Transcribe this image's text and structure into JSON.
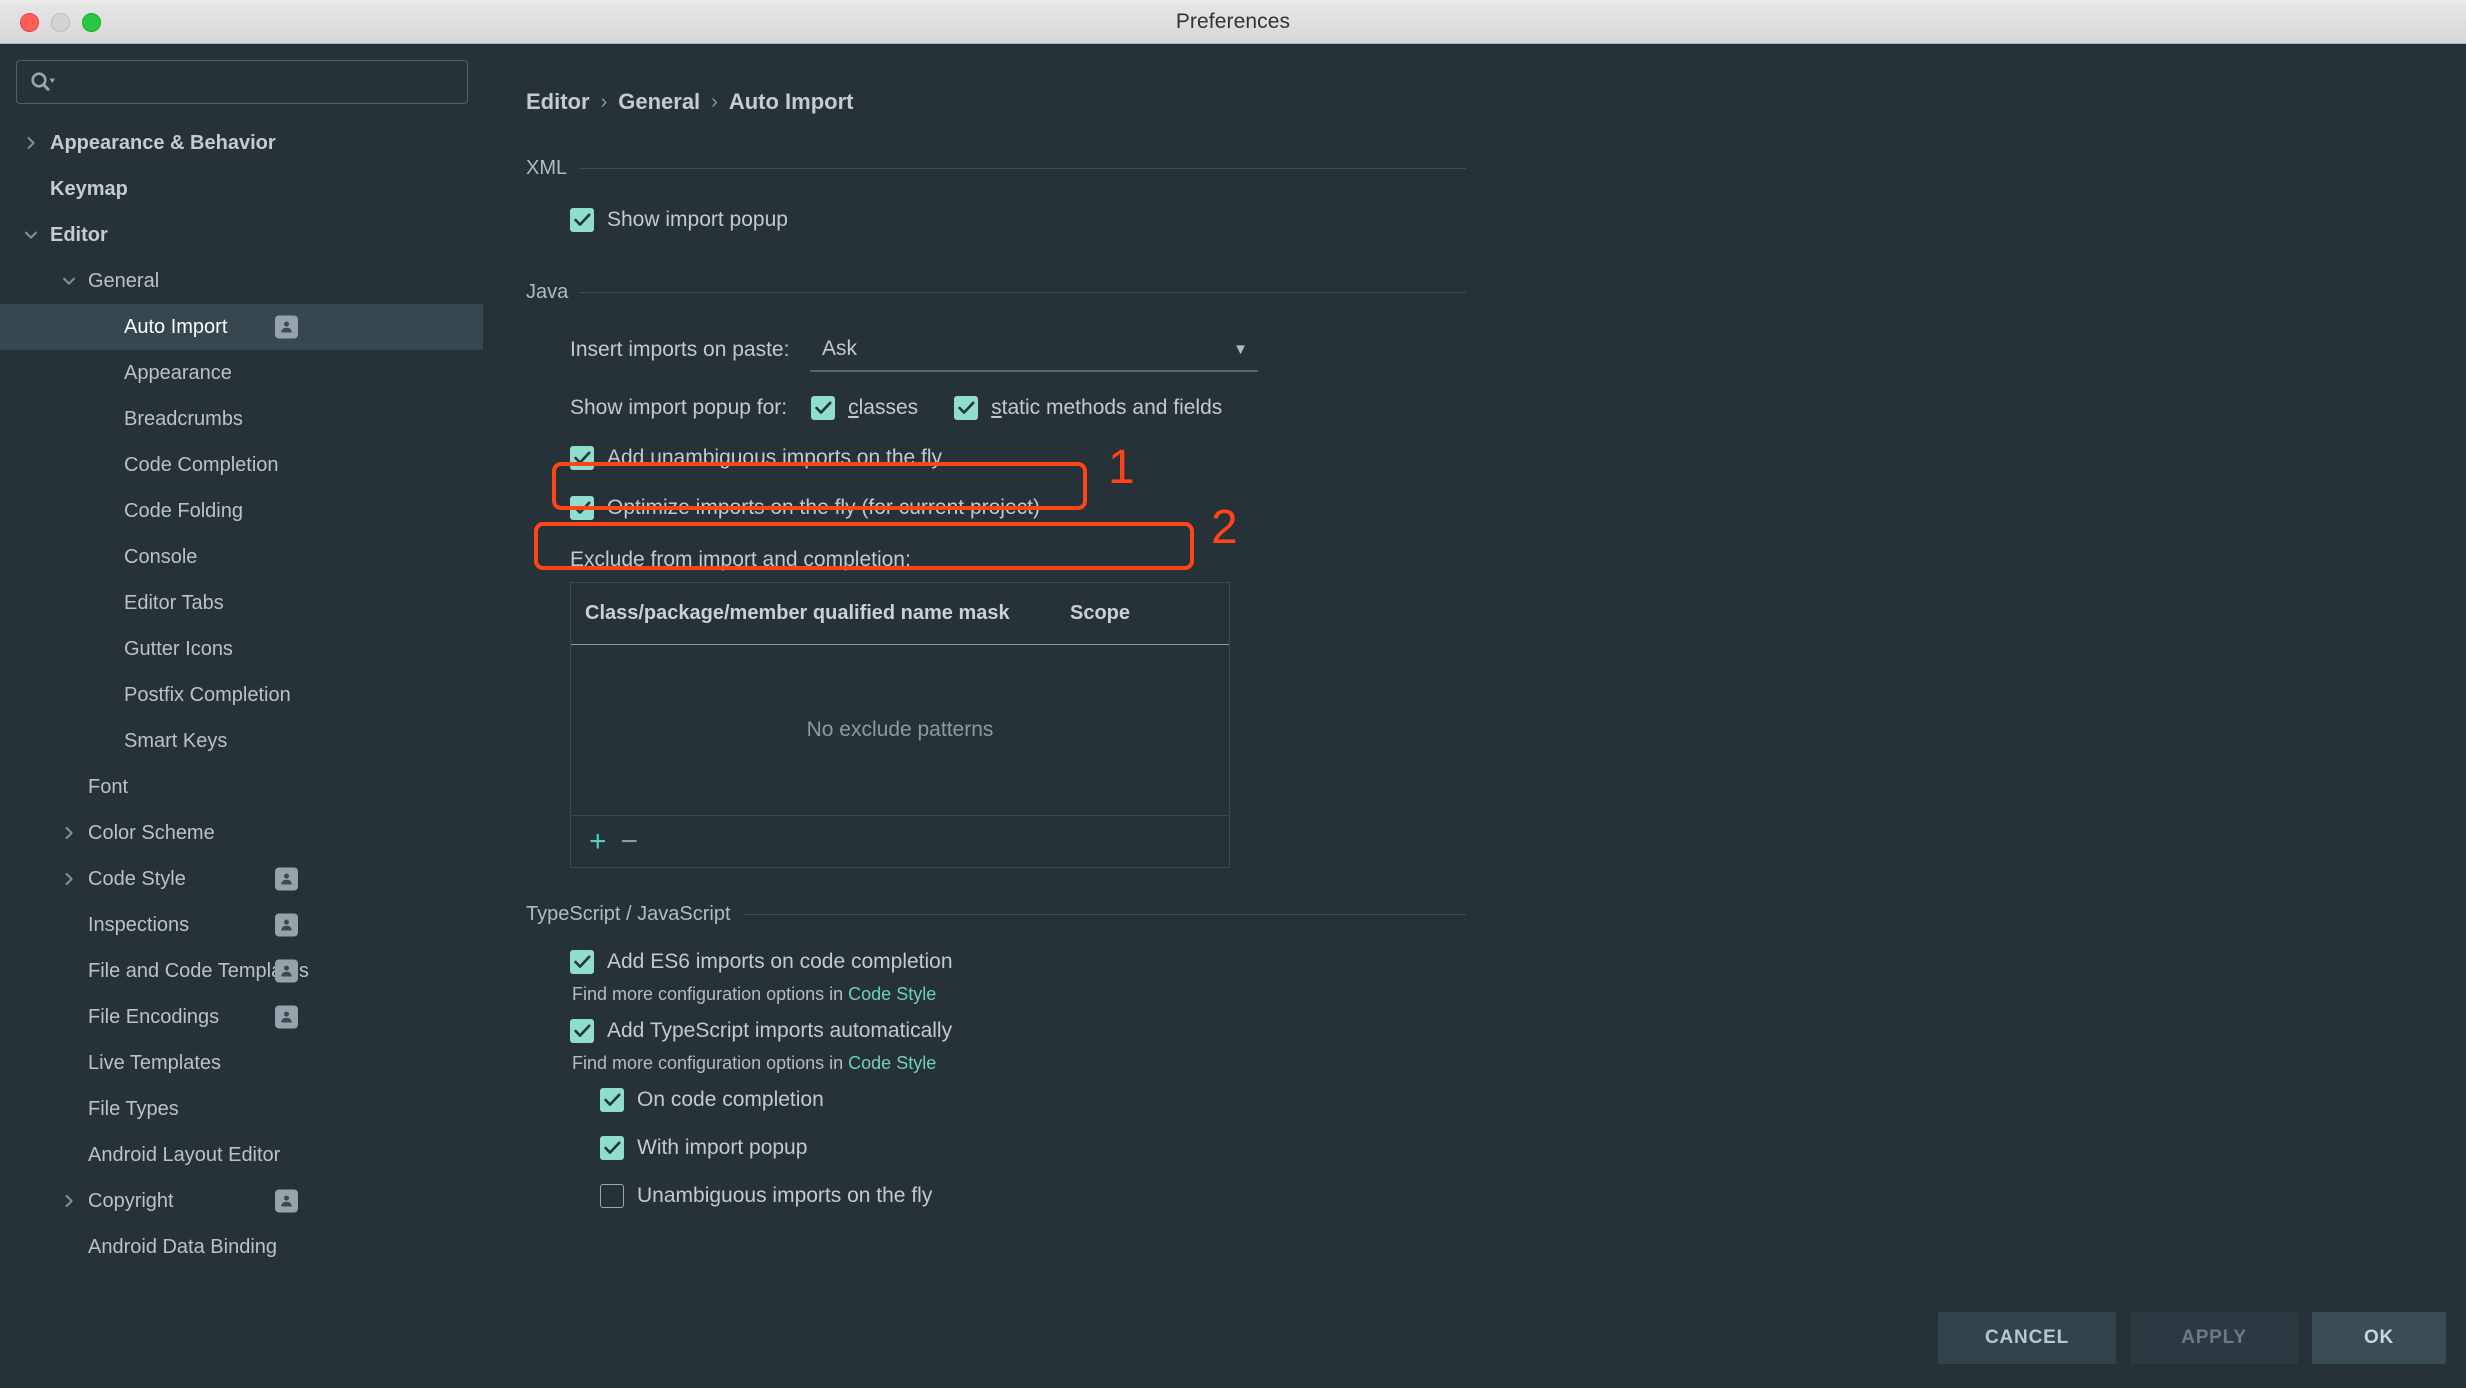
{
  "window": {
    "title": "Preferences"
  },
  "traffic_lights": {
    "close": "close",
    "minimize": "minimize",
    "zoom": "zoom"
  },
  "search": {
    "value": "",
    "placeholder": ""
  },
  "sidebar": {
    "items": [
      {
        "label": "Appearance & Behavior",
        "indent": 0,
        "chevron": "right",
        "bold": true,
        "selected": false,
        "badge": false
      },
      {
        "label": "Keymap",
        "indent": 0,
        "chevron": "none",
        "bold": true,
        "selected": false,
        "badge": false
      },
      {
        "label": "Editor",
        "indent": 0,
        "chevron": "down",
        "bold": true,
        "selected": false,
        "badge": false
      },
      {
        "label": "General",
        "indent": 1,
        "chevron": "down",
        "bold": false,
        "selected": false,
        "badge": false
      },
      {
        "label": "Auto Import",
        "indent": 2,
        "chevron": "none",
        "bold": false,
        "selected": true,
        "badge": true
      },
      {
        "label": "Appearance",
        "indent": 2,
        "chevron": "none",
        "bold": false,
        "selected": false,
        "badge": false
      },
      {
        "label": "Breadcrumbs",
        "indent": 2,
        "chevron": "none",
        "bold": false,
        "selected": false,
        "badge": false
      },
      {
        "label": "Code Completion",
        "indent": 2,
        "chevron": "none",
        "bold": false,
        "selected": false,
        "badge": false
      },
      {
        "label": "Code Folding",
        "indent": 2,
        "chevron": "none",
        "bold": false,
        "selected": false,
        "badge": false
      },
      {
        "label": "Console",
        "indent": 2,
        "chevron": "none",
        "bold": false,
        "selected": false,
        "badge": false
      },
      {
        "label": "Editor Tabs",
        "indent": 2,
        "chevron": "none",
        "bold": false,
        "selected": false,
        "badge": false
      },
      {
        "label": "Gutter Icons",
        "indent": 2,
        "chevron": "none",
        "bold": false,
        "selected": false,
        "badge": false
      },
      {
        "label": "Postfix Completion",
        "indent": 2,
        "chevron": "none",
        "bold": false,
        "selected": false,
        "badge": false
      },
      {
        "label": "Smart Keys",
        "indent": 2,
        "chevron": "none",
        "bold": false,
        "selected": false,
        "badge": false
      },
      {
        "label": "Font",
        "indent": 1,
        "chevron": "none",
        "bold": false,
        "selected": false,
        "badge": false
      },
      {
        "label": "Color Scheme",
        "indent": 1,
        "chevron": "right",
        "bold": false,
        "selected": false,
        "badge": false
      },
      {
        "label": "Code Style",
        "indent": 1,
        "chevron": "right",
        "bold": false,
        "selected": false,
        "badge": true
      },
      {
        "label": "Inspections",
        "indent": 1,
        "chevron": "none",
        "bold": false,
        "selected": false,
        "badge": true
      },
      {
        "label": "File and Code Templates",
        "indent": 1,
        "chevron": "none",
        "bold": false,
        "selected": false,
        "badge": true
      },
      {
        "label": "File Encodings",
        "indent": 1,
        "chevron": "none",
        "bold": false,
        "selected": false,
        "badge": true
      },
      {
        "label": "Live Templates",
        "indent": 1,
        "chevron": "none",
        "bold": false,
        "selected": false,
        "badge": false
      },
      {
        "label": "File Types",
        "indent": 1,
        "chevron": "none",
        "bold": false,
        "selected": false,
        "badge": false
      },
      {
        "label": "Android Layout Editor",
        "indent": 1,
        "chevron": "none",
        "bold": false,
        "selected": false,
        "badge": false
      },
      {
        "label": "Copyright",
        "indent": 1,
        "chevron": "right",
        "bold": false,
        "selected": false,
        "badge": true
      },
      {
        "label": "Android Data Binding",
        "indent": 1,
        "chevron": "none",
        "bold": false,
        "selected": false,
        "badge": false
      }
    ]
  },
  "breadcrumb": {
    "parts": [
      "Editor",
      "General",
      "Auto Import"
    ],
    "separator": "›"
  },
  "sections": {
    "xml": {
      "title": "XML",
      "show_import_popup": {
        "label": "Show import popup",
        "checked": true
      }
    },
    "java": {
      "title": "Java",
      "insert_imports_on_paste": {
        "label": "Insert imports on paste:",
        "value": "Ask"
      },
      "show_import_popup_for": {
        "label": "Show import popup for:",
        "options": [
          {
            "label": "classes",
            "mnemonic": "c",
            "rest": "lasses",
            "checked": true
          },
          {
            "label": "static methods and fields",
            "mnemonic": "s",
            "rest": "tatic methods and fields",
            "checked": true
          }
        ]
      },
      "add_unambiguous": {
        "label": "Add unambiguous imports on the fly",
        "checked": true
      },
      "optimize_imports": {
        "label": "Optimize imports on the fly (for current project)",
        "checked": true
      },
      "exclude_label": "Exclude from import and completion:",
      "exclude_table": {
        "columns": [
          "Class/package/member qualified name mask",
          "Scope"
        ],
        "rows": [],
        "empty_text": "No exclude patterns",
        "add_button": "+",
        "remove_button": "−"
      }
    },
    "ts_js": {
      "title": "TypeScript / JavaScript",
      "add_es6": {
        "label": "Add ES6 imports on code completion",
        "checked": true
      },
      "hint_es6": {
        "prefix": "Find more configuration options in ",
        "link": "Code Style"
      },
      "add_ts": {
        "label": "Add TypeScript imports automatically",
        "checked": true
      },
      "hint_ts": {
        "prefix": "Find more configuration options in ",
        "link": "Code Style"
      },
      "on_code_completion": {
        "label": "On code completion",
        "checked": true
      },
      "with_import_popup": {
        "label": "With import popup",
        "checked": true
      },
      "unambiguous_on_fly": {
        "label": "Unambiguous imports on the fly",
        "checked": false
      }
    }
  },
  "annotations": [
    {
      "number": "1",
      "target": "add-unambiguous-imports-checkbox"
    },
    {
      "number": "2",
      "target": "optimize-imports-checkbox"
    }
  ],
  "footer": {
    "cancel": "CANCEL",
    "apply": "APPLY",
    "ok": "OK"
  },
  "help": {
    "glyph": "?"
  },
  "colors": {
    "background": "#263238",
    "sidebar_selection": "#37474f",
    "checkbox_on": "#8fdecb",
    "link": "#6fd0b8",
    "annotation": "#ff4417",
    "help_icon": "#f0426a",
    "titlebar": "#d6d6d6"
  }
}
